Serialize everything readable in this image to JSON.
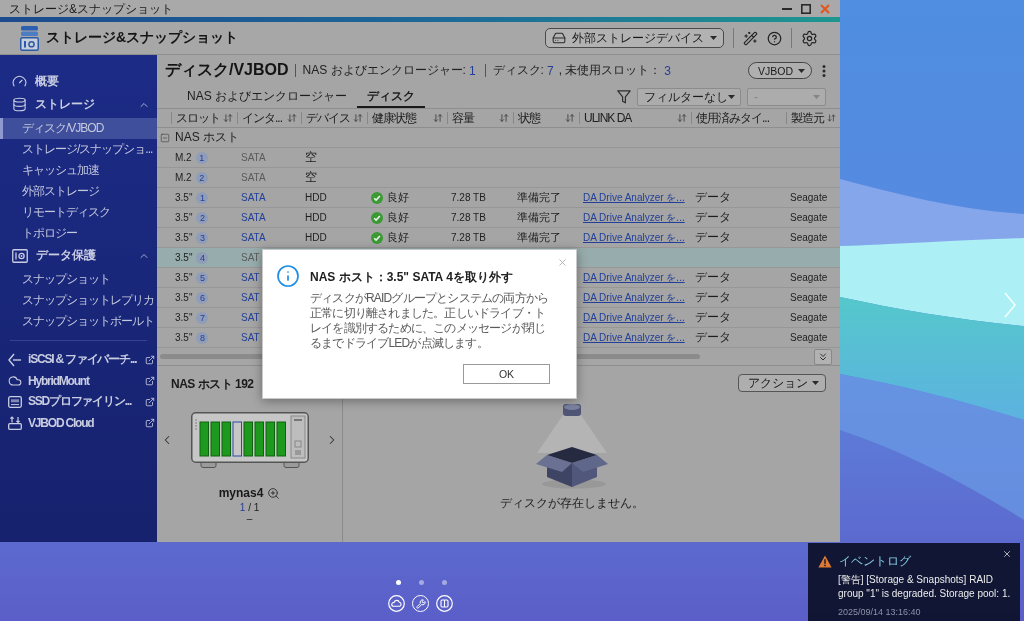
{
  "window": {
    "title": "ストレージ&スナップショット"
  },
  "header": {
    "app_title": "ストレージ&スナップショット",
    "device_button": "外部ストレージデバイス"
  },
  "sidebar": {
    "sections": [
      {
        "label": "概要",
        "selected": false
      },
      {
        "label": "ストレージ",
        "selected": false,
        "expanded": true,
        "items": [
          {
            "label": "ディスク/VJBOD",
            "selected": true
          },
          {
            "label": "ストレージ/スナップショ...",
            "selected": false
          },
          {
            "label": "キャッシュ加速",
            "selected": false
          },
          {
            "label": "外部ストレージ",
            "selected": false
          },
          {
            "label": "リモートディスク",
            "selected": false
          },
          {
            "label": "トポロジー",
            "selected": false
          }
        ]
      },
      {
        "label": "データ保護",
        "selected": false,
        "expanded": true,
        "items": [
          {
            "label": "スナップショット",
            "selected": false
          },
          {
            "label": "スナップショットレプリカ",
            "selected": false
          },
          {
            "label": "スナップショットボールト",
            "selected": false
          }
        ]
      }
    ],
    "links": [
      {
        "label": "iSCSI & ファイバーチ..."
      },
      {
        "label": "HybridMount"
      },
      {
        "label": "SSDプロファイリン..."
      },
      {
        "label": "VJBOD Cloud"
      }
    ]
  },
  "page": {
    "title": "ディスク/VJBOD",
    "stats": [
      {
        "items": [
          {
            "label": "NAS およびエンクロージャー:",
            "value": "1"
          }
        ]
      },
      {
        "items": [
          {
            "label": "ディスク:",
            "value": "7"
          },
          {
            "label": ", 未使用スロット：",
            "value": "3"
          }
        ]
      }
    ],
    "view_button": "VJBOD"
  },
  "tabs": [
    {
      "label": "NAS およびエンクロージャー",
      "selected": false
    },
    {
      "label": "ディスク",
      "selected": true
    }
  ],
  "filters": [
    {
      "value": "フィルターなし",
      "disabled": false
    },
    {
      "value": "-",
      "disabled": true
    }
  ],
  "table": {
    "columns": [
      {
        "label": "スロット",
        "sortable": true
      },
      {
        "label": "インタ...",
        "sortable": true
      },
      {
        "label": "デバイス",
        "sortable": true
      },
      {
        "label": "健康状態",
        "sortable": true
      },
      {
        "label": "容量",
        "sortable": true
      },
      {
        "label": "状態",
        "sortable": true
      },
      {
        "label": "ULINK DA",
        "sortable": true
      },
      {
        "label": "使用済みタイ...",
        "sortable": false
      },
      {
        "label": "製造元",
        "sortable": true
      }
    ],
    "group": {
      "label": "NAS ホスト",
      "expanded": true
    },
    "rows": [
      {
        "kind": "empty",
        "selected": false,
        "slot": "M.2",
        "number": "1",
        "interface": "SATA",
        "device": "空"
      },
      {
        "kind": "empty",
        "selected": false,
        "slot": "M.2",
        "number": "2",
        "interface": "SATA",
        "device": "空"
      },
      {
        "kind": "disk",
        "selected": false,
        "slot": "3.5\"",
        "number": "1",
        "interface": "SATA",
        "device": "HDD",
        "health": {
          "label": "良好",
          "kind": "good"
        },
        "capacity": "7.28 TB",
        "status": "準備完了",
        "ulink": "DA Drive Analyzer を...",
        "usage_type": "データ",
        "manufacturer": "Seagate"
      },
      {
        "kind": "disk",
        "selected": false,
        "slot": "3.5\"",
        "number": "2",
        "interface": "SATA",
        "device": "HDD",
        "health": {
          "label": "良好",
          "kind": "good"
        },
        "capacity": "7.28 TB",
        "status": "準備完了",
        "ulink": "DA Drive Analyzer を...",
        "usage_type": "データ",
        "manufacturer": "Seagate"
      },
      {
        "kind": "disk",
        "selected": false,
        "slot": "3.5\"",
        "number": "3",
        "interface": "SATA",
        "device": "HDD",
        "health": {
          "label": "良好",
          "kind": "good"
        },
        "capacity": "7.28 TB",
        "status": "準備完了",
        "ulink": "DA Drive Analyzer を...",
        "usage_type": "データ",
        "manufacturer": "Seagate"
      },
      {
        "kind": "empty",
        "selected": true,
        "slot": "3.5\"",
        "number": "4",
        "interface": "SAT"
      },
      {
        "kind": "disk",
        "selected": false,
        "slot": "3.5\"",
        "number": "5",
        "interface": "SAT",
        "ulink": "DA Drive Analyzer を...",
        "usage_type": "データ",
        "manufacturer": "Seagate"
      },
      {
        "kind": "disk",
        "selected": false,
        "slot": "3.5\"",
        "number": "6",
        "interface": "SAT",
        "ulink": "DA Drive Analyzer を...",
        "usage_type": "データ",
        "manufacturer": "Seagate"
      },
      {
        "kind": "disk",
        "selected": false,
        "slot": "3.5\"",
        "number": "7",
        "interface": "SAT",
        "ulink": "DA Drive Analyzer を...",
        "usage_type": "データ",
        "manufacturer": "Seagate"
      },
      {
        "kind": "disk",
        "selected": false,
        "slot": "3.5\"",
        "number": "8",
        "interface": "SAT",
        "ulink": "DA Drive Analyzer を...",
        "usage_type": "データ",
        "manufacturer": "Seagate"
      }
    ]
  },
  "device_panel": {
    "title": "NAS ホスト 192",
    "bays": [
      {
        "filled": true
      },
      {
        "filled": true
      },
      {
        "filled": true
      },
      {
        "filled": false
      },
      {
        "filled": true
      },
      {
        "filled": true
      },
      {
        "filled": true
      },
      {
        "filled": true
      }
    ],
    "name": "mynas4",
    "pager": {
      "current": "1",
      "rest": "/ 1"
    },
    "status": "–"
  },
  "disk_panel": {
    "action_button": "アクション",
    "empty_message": "ディスクが存在しません。"
  },
  "dialog": {
    "title": "NAS ホスト：3.5\" SATA 4を取り外す",
    "message": "ディスクがRAIDグループとシステムの両方から正常に切り離されました。正しいドライブ・トレイを識別するために、このメッセージが閉じるまでドライブLEDが点滅します。",
    "ok_button": "OK"
  },
  "desktop": {
    "page_dots": [
      {
        "selected": true
      },
      {
        "selected": false
      },
      {
        "selected": false
      }
    ]
  },
  "notification": {
    "title": "イベントログ",
    "message": "[警告] [Storage & Snapshots] RAID group \"1\" is degraded. Storage pool: 1.",
    "timestamp": "2025/09/14 13:16:40"
  }
}
